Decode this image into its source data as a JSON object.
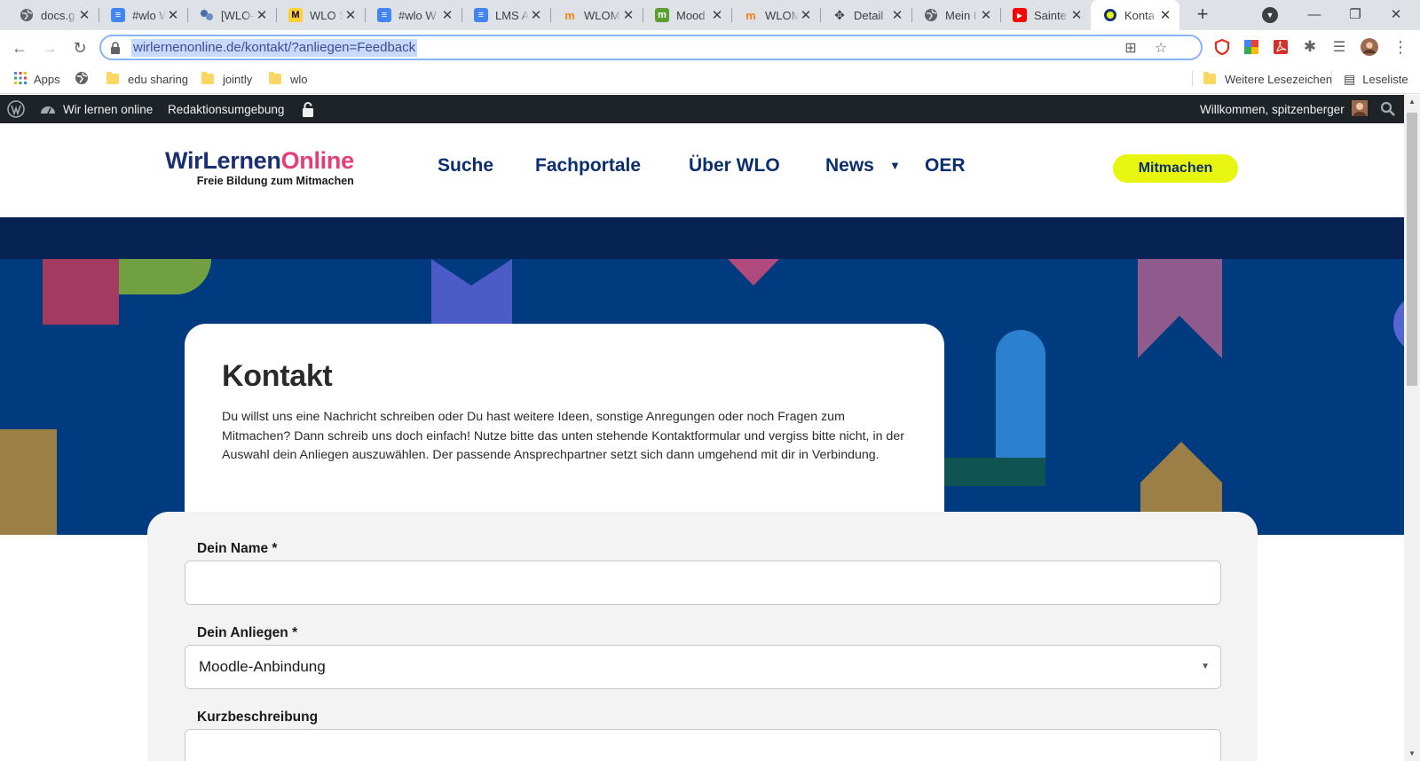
{
  "browser": {
    "tabs": [
      {
        "title": "docs.g",
        "icon": "globe-icon"
      },
      {
        "title": "#wlo W",
        "icon": "docs-icon"
      },
      {
        "title": "[WLO-",
        "icon": "jira-icon"
      },
      {
        "title": "WLO S",
        "icon": "miro-icon"
      },
      {
        "title": "#wlo W",
        "icon": "docs-icon"
      },
      {
        "title": "LMS A",
        "icon": "docs-icon"
      },
      {
        "title": "WLOM",
        "icon": "moodle-icon"
      },
      {
        "title": "Mood",
        "icon": "moodle-green-icon"
      },
      {
        "title": "WLOM",
        "icon": "moodle-icon"
      },
      {
        "title": "Detail",
        "icon": "git-icon"
      },
      {
        "title": "Mein I",
        "icon": "globe-icon"
      },
      {
        "title": "Sainte",
        "icon": "youtube-icon"
      },
      {
        "title": "Konta",
        "icon": "wlo-icon",
        "active": true
      }
    ],
    "address": "wirlernenonline.de/kontakt/?anliegen=Feedback",
    "bookmarks": {
      "apps": "Apps",
      "items": [
        "edu sharing",
        "jointly",
        "wlo"
      ],
      "more": "Weitere Lesezeichen",
      "reading_list": "Leseliste"
    }
  },
  "adminbar": {
    "site": "Wir lernen online",
    "editorial": "Redaktionsumgebung",
    "welcome": "Willkommen, spitzenberger"
  },
  "site": {
    "logo_main": "WirLernen",
    "logo_accent": "Online",
    "logo_tagline": "Freie Bildung zum Mitmachen",
    "nav": [
      "Suche",
      "Fachportale",
      "Über WLO",
      "News",
      "OER"
    ],
    "cta": "Mitmachen"
  },
  "contact": {
    "title": "Kontakt",
    "intro": "Du willst uns eine Nachricht schreiben oder Du hast weitere Ideen, sonstige Anregungen oder noch Fragen zum Mitmachen? Dann schreib uns doch einfach! Nutze bitte das unten stehende Kontaktformular und vergiss bitte nicht, in der Auswahl dein Anliegen auszuwählen. Der passende Ansprechpartner setzt sich dann umgehend mit dir in Verbindung."
  },
  "form": {
    "name_label": "Dein Name *",
    "name_value": "",
    "concern_label": "Dein Anliegen *",
    "concern_value": "Moodle-Anbindung",
    "summary_label": "Kurzbeschreibung",
    "summary_value": ""
  },
  "colors": {
    "brand_blue": "#1a2f72",
    "brand_pink": "#e63e74",
    "cta_yellow": "#e8f60f",
    "hero_blue": "#003a7f"
  }
}
